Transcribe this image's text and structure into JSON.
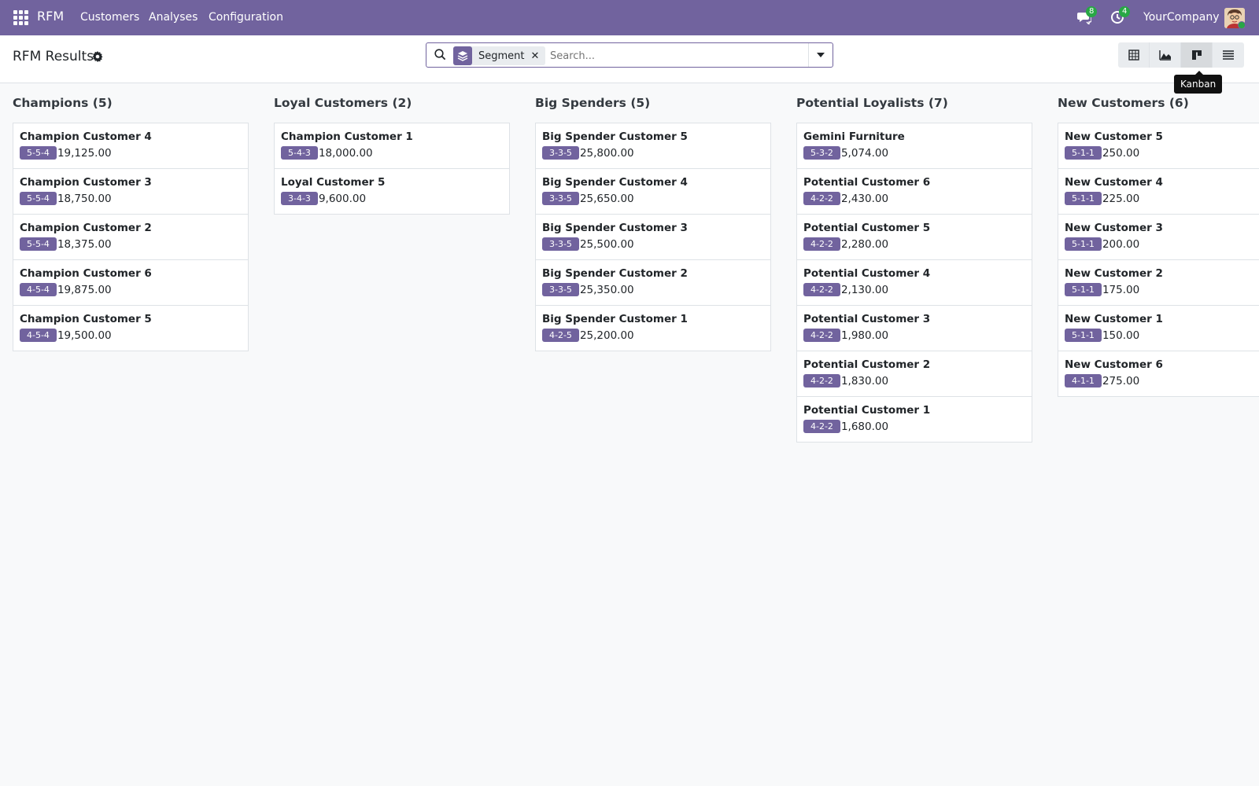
{
  "nav": {
    "brand": "RFM",
    "menu": [
      "Customers",
      "Analyses",
      "Configuration"
    ],
    "messages_count": "8",
    "activities_count": "4",
    "company": "YourCompany"
  },
  "control": {
    "title": "RFM Results",
    "facet": "Segment",
    "search_placeholder": "Search...",
    "tooltip": "Kanban"
  },
  "columns": [
    {
      "title": "Champions",
      "count": "(5)",
      "cards": [
        {
          "name": "Champion Customer 4",
          "score": "5-5-4",
          "amount": "19,125.00"
        },
        {
          "name": "Champion Customer 3",
          "score": "5-5-4",
          "amount": "18,750.00"
        },
        {
          "name": "Champion Customer 2",
          "score": "5-5-4",
          "amount": "18,375.00"
        },
        {
          "name": "Champion Customer 6",
          "score": "4-5-4",
          "amount": "19,875.00"
        },
        {
          "name": "Champion Customer 5",
          "score": "4-5-4",
          "amount": "19,500.00"
        }
      ]
    },
    {
      "title": "Loyal Customers",
      "count": "(2)",
      "cards": [
        {
          "name": "Champion Customer 1",
          "score": "5-4-3",
          "amount": "18,000.00"
        },
        {
          "name": "Loyal Customer 5",
          "score": "3-4-3",
          "amount": "9,600.00"
        }
      ]
    },
    {
      "title": "Big Spenders",
      "count": "(5)",
      "cards": [
        {
          "name": "Big Spender Customer 5",
          "score": "3-3-5",
          "amount": "25,800.00"
        },
        {
          "name": "Big Spender Customer 4",
          "score": "3-3-5",
          "amount": "25,650.00"
        },
        {
          "name": "Big Spender Customer 3",
          "score": "3-3-5",
          "amount": "25,500.00"
        },
        {
          "name": "Big Spender Customer 2",
          "score": "3-3-5",
          "amount": "25,350.00"
        },
        {
          "name": "Big Spender Customer 1",
          "score": "4-2-5",
          "amount": "25,200.00"
        }
      ]
    },
    {
      "title": "Potential Loyalists",
      "count": "(7)",
      "cards": [
        {
          "name": "Gemini Furniture",
          "score": "5-3-2",
          "amount": "5,074.00"
        },
        {
          "name": "Potential Customer 6",
          "score": "4-2-2",
          "amount": "2,430.00"
        },
        {
          "name": "Potential Customer 5",
          "score": "4-2-2",
          "amount": "2,280.00"
        },
        {
          "name": "Potential Customer 4",
          "score": "4-2-2",
          "amount": "2,130.00"
        },
        {
          "name": "Potential Customer 3",
          "score": "4-2-2",
          "amount": "1,980.00"
        },
        {
          "name": "Potential Customer 2",
          "score": "4-2-2",
          "amount": "1,830.00"
        },
        {
          "name": "Potential Customer 1",
          "score": "4-2-2",
          "amount": "1,680.00"
        }
      ]
    },
    {
      "title": "New Customers",
      "count": "(6)",
      "cards": [
        {
          "name": "New Customer 5",
          "score": "5-1-1",
          "amount": "250.00"
        },
        {
          "name": "New Customer 4",
          "score": "5-1-1",
          "amount": "225.00"
        },
        {
          "name": "New Customer 3",
          "score": "5-1-1",
          "amount": "200.00"
        },
        {
          "name": "New Customer 2",
          "score": "5-1-1",
          "amount": "175.00"
        },
        {
          "name": "New Customer 1",
          "score": "5-1-1",
          "amount": "150.00"
        },
        {
          "name": "New Customer 6",
          "score": "4-1-1",
          "amount": "275.00"
        }
      ]
    }
  ]
}
